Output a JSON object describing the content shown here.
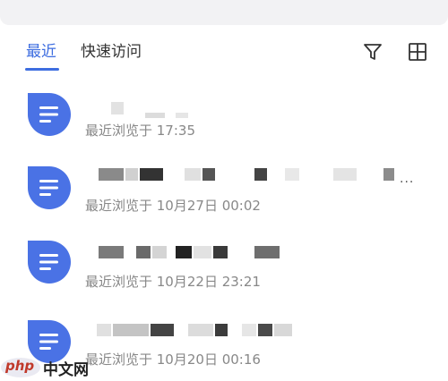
{
  "tabs": {
    "recent_label": "最近",
    "quick_access_label": "快速访问"
  },
  "toolbar": {
    "filter_icon": "filter-icon",
    "grid_icon": "grid-view-icon"
  },
  "colors": {
    "accent": "#3d6de0",
    "doc_icon": "#4a72e5"
  },
  "files": [
    {
      "icon": "document-icon",
      "viewed": "最近浏览于 17:35"
    },
    {
      "icon": "document-icon",
      "viewed": "最近浏览于 10月27日 00:02"
    },
    {
      "icon": "document-icon",
      "viewed": "最近浏览于 10月22日 23:21"
    },
    {
      "icon": "document-icon",
      "viewed": "最近浏览于 10月20日 00:16"
    }
  ],
  "item_more": "···",
  "watermark": {
    "logo_text": "php",
    "site_text": "中文网"
  }
}
